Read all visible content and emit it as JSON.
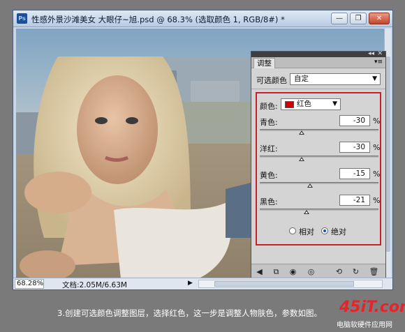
{
  "window": {
    "app_icon": "Ps",
    "title": "性感外景沙滩美女  大眼仔~旭.psd @ 68.3% (选取颜色 1, RGB/8#) *",
    "btn_min": "—",
    "btn_max": "❐",
    "btn_close": "✕"
  },
  "status": {
    "zoom": "68.28%",
    "doc_info": "文档:2.05M/6.63M",
    "arrow": "▶"
  },
  "panel": {
    "top_icons": {
      "collapse": "◂◂",
      "close": "✕"
    },
    "tab": "调整",
    "preset_label": "可选颜色",
    "preset_value": "自定",
    "color_label": "颜色:",
    "color_value": "红色",
    "swatch_color": "#d40000",
    "sliders": [
      {
        "label": "青色:",
        "value": "-30",
        "unit": "%",
        "level": -30
      },
      {
        "label": "洋红:",
        "value": "-30",
        "unit": "%",
        "level": -30
      },
      {
        "label": "黄色:",
        "value": "-15",
        "unit": "%",
        "level": -15
      },
      {
        "label": "黑色:",
        "value": "-21",
        "unit": "%",
        "level": -21
      }
    ],
    "radio_relative": "相对",
    "radio_absolute": "绝对",
    "radio_selected": "绝对"
  },
  "caption": "3.创建可选颜色调整图层，选择红色，这一步是调整人物肤色，参数如图。",
  "logo": {
    "main": "45iT.com",
    "sub": "电脑软硬件应用网"
  },
  "icons": {
    "back": "back-arrow-icon",
    "clip": "clip-layer-icon",
    "mask": "mask-icon",
    "visibility": "eye-icon",
    "previous": "view-previous-icon",
    "reset": "reset-icon",
    "delete": "trash-icon"
  }
}
